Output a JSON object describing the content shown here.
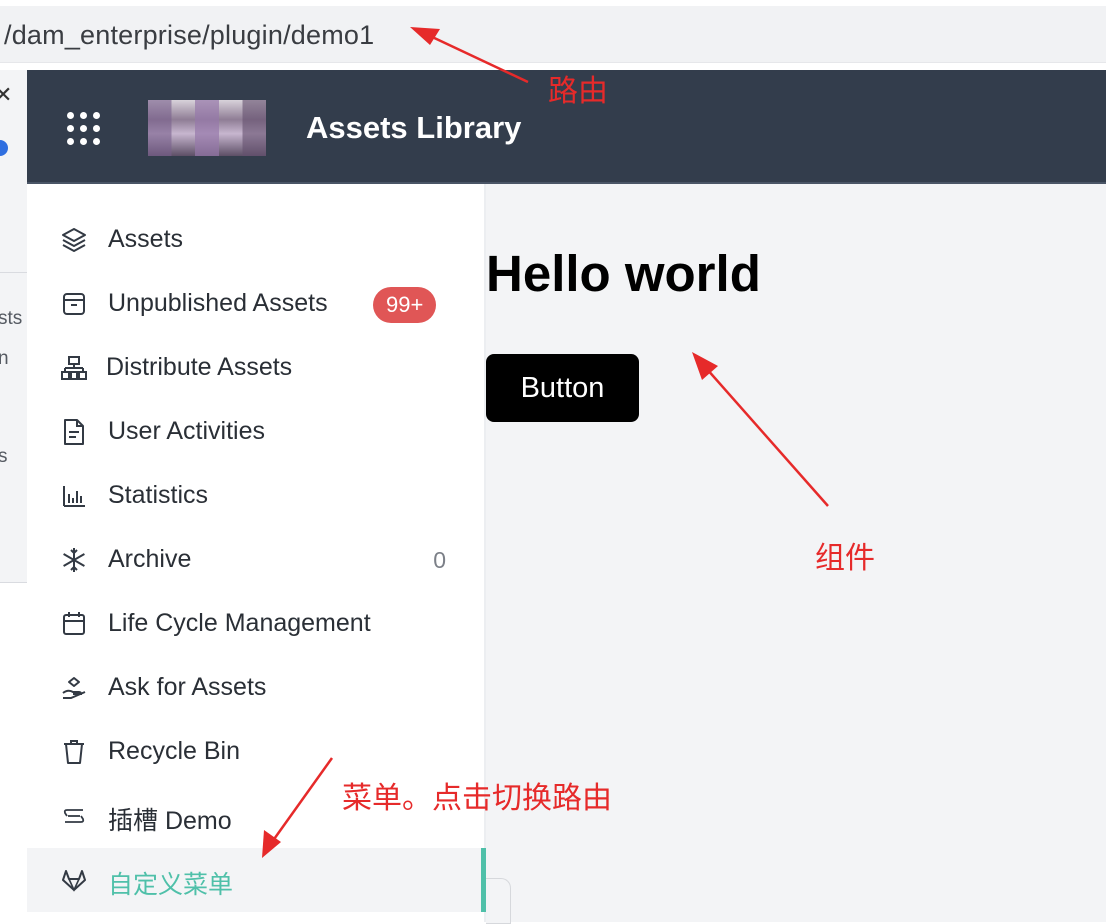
{
  "browser": {
    "url": "/dam_enterprise/plugin/demo1"
  },
  "header": {
    "title": "Assets Library",
    "apps_icon": "grid-dots-icon",
    "logo": "logo-thumbnail"
  },
  "left_strip": {
    "fragments": [
      "sts",
      "n",
      "s"
    ]
  },
  "sidebar": {
    "items": [
      {
        "label": "Assets",
        "icon": "layers-icon"
      },
      {
        "label": "Unpublished Assets",
        "icon": "archive-box-icon",
        "badge": "99+"
      },
      {
        "label": "Distribute Assets",
        "icon": "sitemap-icon"
      },
      {
        "label": "User Activities",
        "icon": "document-icon"
      },
      {
        "label": "Statistics",
        "icon": "bar-chart-icon"
      },
      {
        "label": "Archive",
        "icon": "snowflake-icon",
        "count": "0"
      },
      {
        "label": "Life Cycle Management",
        "icon": "calendar-icon"
      },
      {
        "label": "Ask for Assets",
        "icon": "hand-icon"
      },
      {
        "label": "Recycle Bin",
        "icon": "trash-icon"
      },
      {
        "label": "插槽 Demo",
        "icon": "route-icon"
      },
      {
        "label": "自定义菜单",
        "icon": "gitlab-icon",
        "active": true
      }
    ],
    "active_color": "#4fc0a9"
  },
  "main": {
    "heading": "Hello world",
    "button_label": "Button"
  },
  "annotations": {
    "route": "路由",
    "component": "组件",
    "menu": "菜单。点击切换路由",
    "color": "#e62a2a"
  },
  "colors": {
    "header_bg": "#333d4c",
    "badge": "#e05656",
    "content_bg": "#f3f4f6"
  }
}
